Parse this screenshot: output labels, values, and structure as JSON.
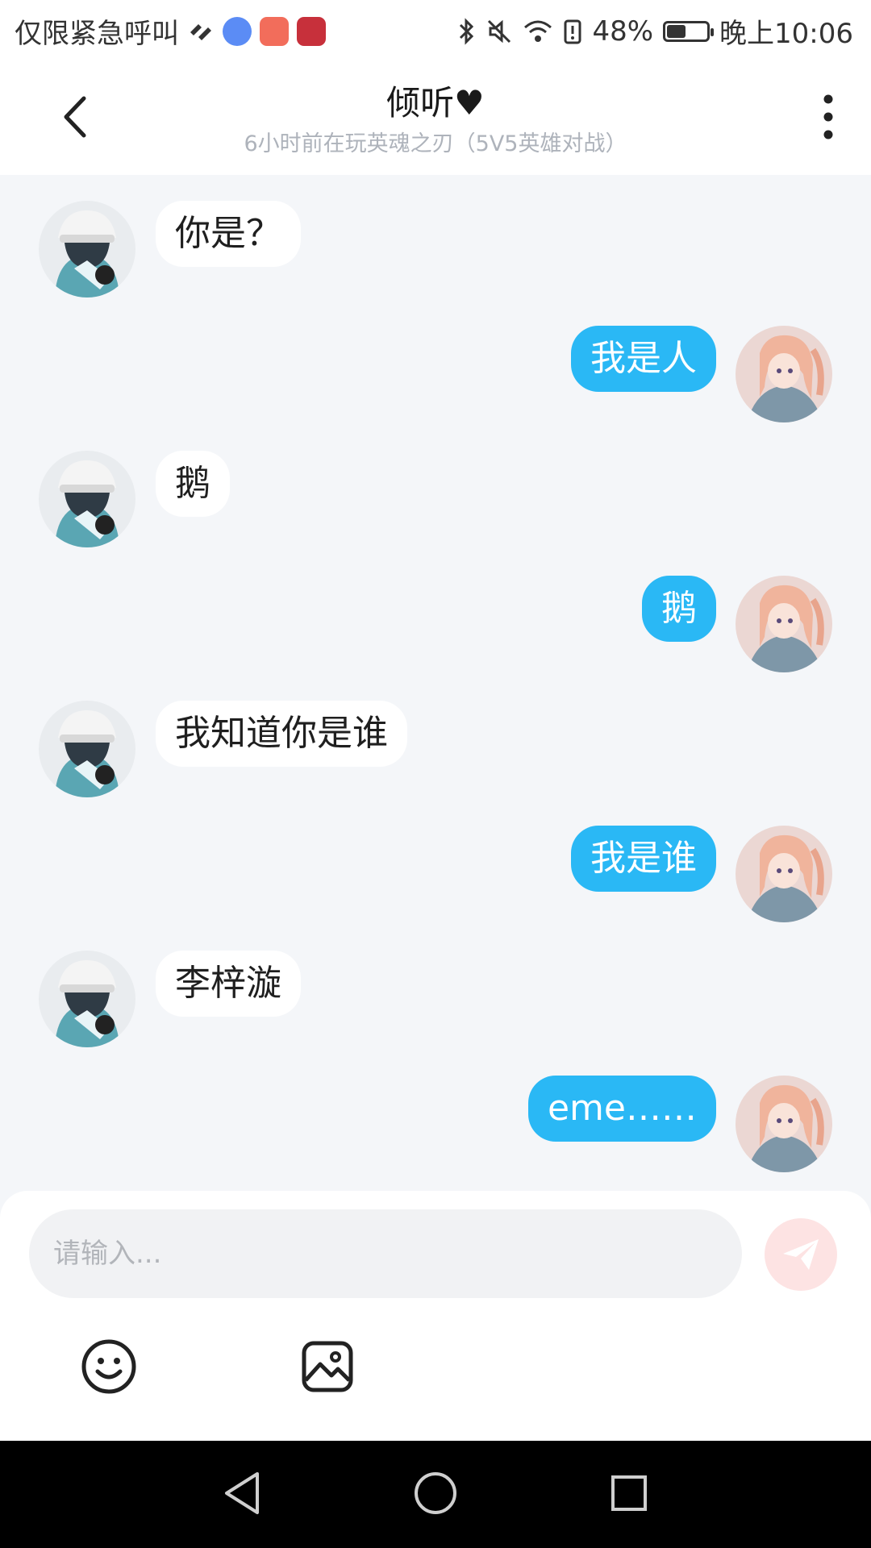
{
  "status_bar": {
    "carrier": "仅限紧急呼叫",
    "battery_level": 0.48,
    "battery_text": "48%",
    "time": "晚上10:06",
    "icons": [
      "signal-heart-icon",
      "music-app-icon",
      "kuaishou-app-icon",
      "douyin-app-icon",
      "bluetooth-icon",
      "mute-icon",
      "wifi-icon",
      "battery-alert-icon",
      "battery-icon"
    ]
  },
  "header": {
    "title": "倾听♥",
    "subtitle": "6小时前在玩英魂之刃（5V5英雄对战）",
    "back_icon": "chevron-left-icon",
    "more_icon": "more-vertical-icon"
  },
  "messages": [
    {
      "side": "left",
      "text": "你是？"
    },
    {
      "side": "right",
      "text": "我是人"
    },
    {
      "side": "left",
      "text": "鹅"
    },
    {
      "side": "right",
      "text": "鹅"
    },
    {
      "side": "left",
      "text": "我知道你是谁"
    },
    {
      "side": "right",
      "text": "我是谁"
    },
    {
      "side": "left",
      "text": "李梓漩"
    },
    {
      "side": "right",
      "text": "eme……"
    }
  ],
  "composer": {
    "placeholder": "请输入...",
    "send_icon": "send-icon",
    "emoji_icon": "emoji-icon",
    "image_icon": "image-icon"
  },
  "colors": {
    "outgoing_bubble": "#2ab8f5",
    "incoming_bubble": "#ffffff",
    "background": "#f4f6f9",
    "send_button": "#fde3e3"
  },
  "nav_bar": {
    "icons": [
      "back-triangle-icon",
      "home-circle-icon",
      "recents-square-icon"
    ]
  }
}
